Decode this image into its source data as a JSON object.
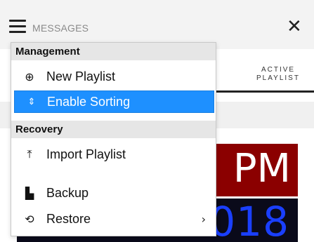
{
  "topbar": {
    "title": "MESSAGES",
    "menu_icon": "hamburger-icon",
    "close_glyph": "✕",
    "close_icon": "close-icon"
  },
  "background": {
    "column_header": "ACTIVE PLAYLIST",
    "clock_suffix": "PM",
    "clock_date_tail": "018"
  },
  "menu": {
    "sections": [
      {
        "label": "Management",
        "items": [
          {
            "label": "New Playlist",
            "icon": "plus-circle-icon",
            "glyph": "⊕",
            "selected": false
          },
          {
            "label": "Enable Sorting",
            "icon": "sort-icon",
            "glyph": "⇕",
            "selected": true
          }
        ]
      },
      {
        "label": "Recovery",
        "items": [
          {
            "label": "Import Playlist",
            "icon": "import-icon",
            "glyph": "⤒",
            "selected": false
          },
          {
            "label": "Backup",
            "icon": "copy-icon",
            "glyph": "▙",
            "selected": false
          },
          {
            "label": "Restore",
            "icon": "restore-icon",
            "glyph": "⟲",
            "selected": false,
            "submenu_glyph": "›"
          }
        ]
      }
    ]
  },
  "colors": {
    "selected_bg": "#1e90ff",
    "section_bg": "#e6e6e6",
    "clock_red": "#8b0000",
    "clock_blue_text": "#1a3fff"
  }
}
